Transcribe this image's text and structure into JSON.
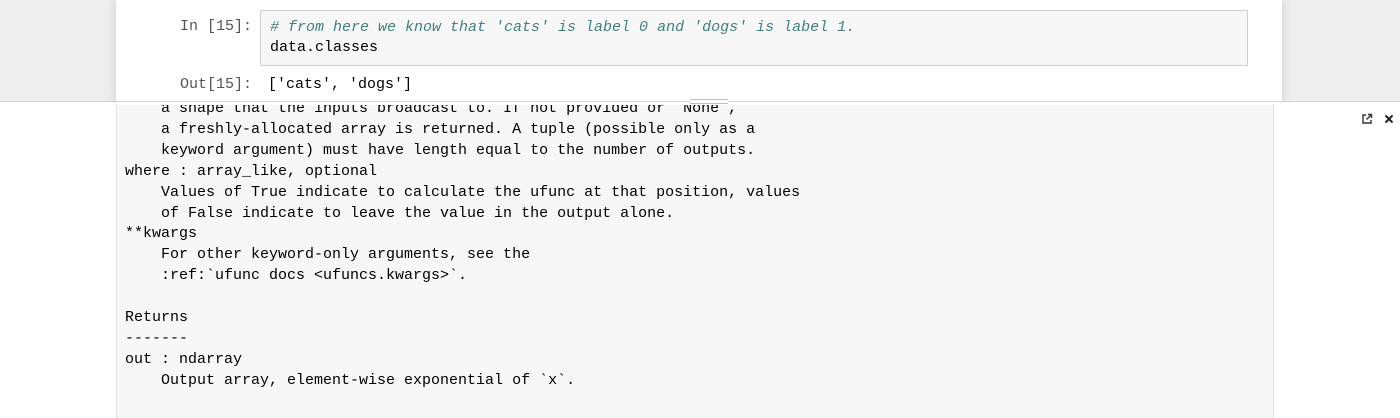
{
  "cell": {
    "in_prompt": "In [15]:",
    "code_comment": "# from here we know that 'cats' is label 0 and 'dogs' is label 1.",
    "code_statement": "data.classes",
    "out_prompt": "Out[15]:",
    "output": "['cats', 'dogs']"
  },
  "pager": {
    "expand_icon": "open-in-new-window-icon",
    "close_icon": "close-icon",
    "lines": [
      "    a shape that the inputs broadcast to. If not provided or `None`,",
      "    a freshly-allocated array is returned. A tuple (possible only as a",
      "    keyword argument) must have length equal to the number of outputs.",
      "where : array_like, optional",
      "    Values of True indicate to calculate the ufunc at that position, values",
      "    of False indicate to leave the value in the output alone.",
      "**kwargs",
      "    For other keyword-only arguments, see the",
      "    :ref:`ufunc docs <ufuncs.kwargs>`.",
      "",
      "Returns",
      "-------",
      "out : ndarray",
      "    Output array, element-wise exponential of `x`."
    ]
  }
}
